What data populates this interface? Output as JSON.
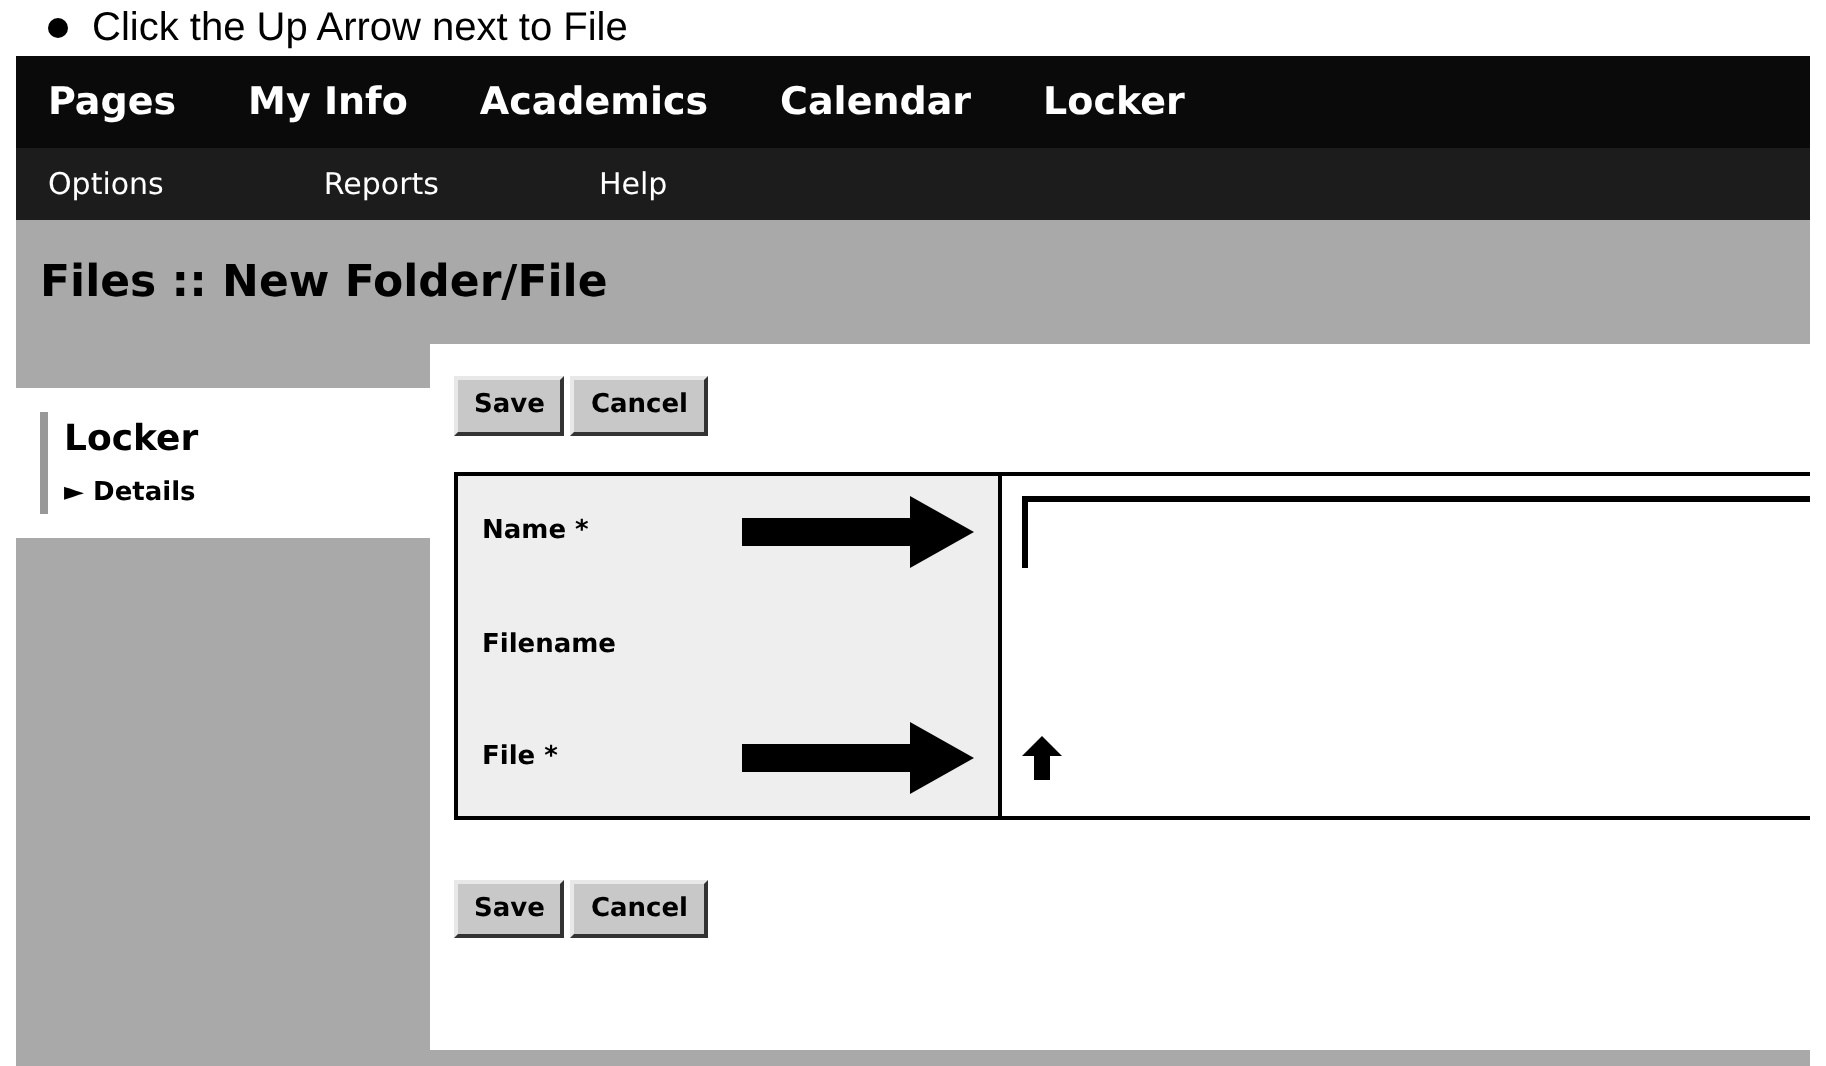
{
  "caption": "Click the Up Arrow next to File",
  "tabs": [
    "Pages",
    "My Info",
    "Academics",
    "Calendar",
    "Locker"
  ],
  "subnav": [
    "Options",
    "Reports",
    "Help"
  ],
  "page_title": "Files :: New Folder/File",
  "sidebar": {
    "title": "Locker",
    "items": [
      {
        "label": "Details",
        "marker": "►"
      }
    ]
  },
  "buttons": [
    "Save",
    "Cancel"
  ],
  "form": {
    "fields": [
      {
        "label": "Name *",
        "kind": "text",
        "pointer": true
      },
      {
        "label": "Filename",
        "kind": "none",
        "pointer": false
      },
      {
        "label": "File *",
        "kind": "upload",
        "pointer": true
      }
    ]
  },
  "bottom_buttons": [
    "Save",
    "Cancel"
  ]
}
